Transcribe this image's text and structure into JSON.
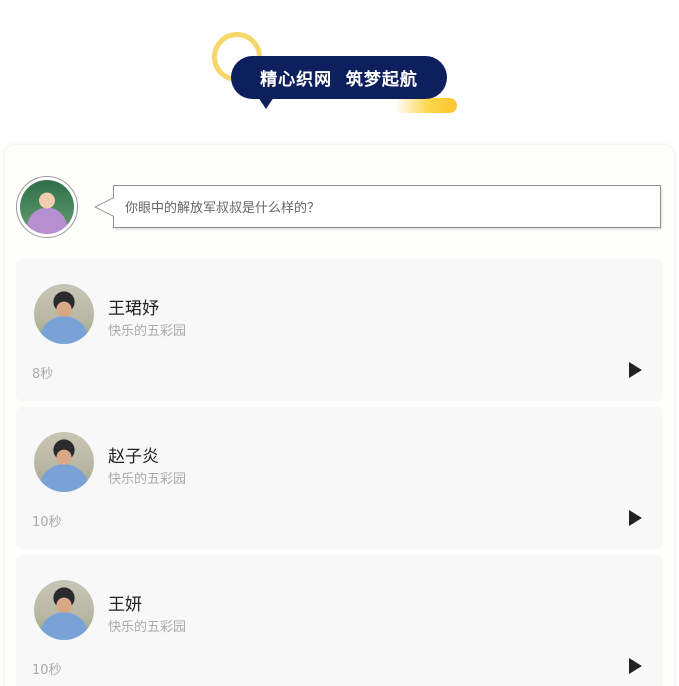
{
  "banner": {
    "title": "精心织网  筑梦起航"
  },
  "question": {
    "text": "你眼中的解放军叔叔是什么样的？"
  },
  "entries": [
    {
      "name": "王珺妤",
      "school": "快乐的五彩园",
      "duration": "8秒"
    },
    {
      "name": "赵子炎",
      "school": "快乐的五彩园",
      "duration": "10秒"
    },
    {
      "name": "王妍",
      "school": "快乐的五彩园",
      "duration": "10秒"
    }
  ],
  "icons": {
    "play": "play-icon",
    "banner_ring": "ring-decoration",
    "banner_stripe": "stripe-decoration"
  },
  "colors": {
    "banner_bg": "#0d1f5c",
    "banner_accent": "#fcd54a",
    "entry_bg": "#f8f8f8"
  }
}
